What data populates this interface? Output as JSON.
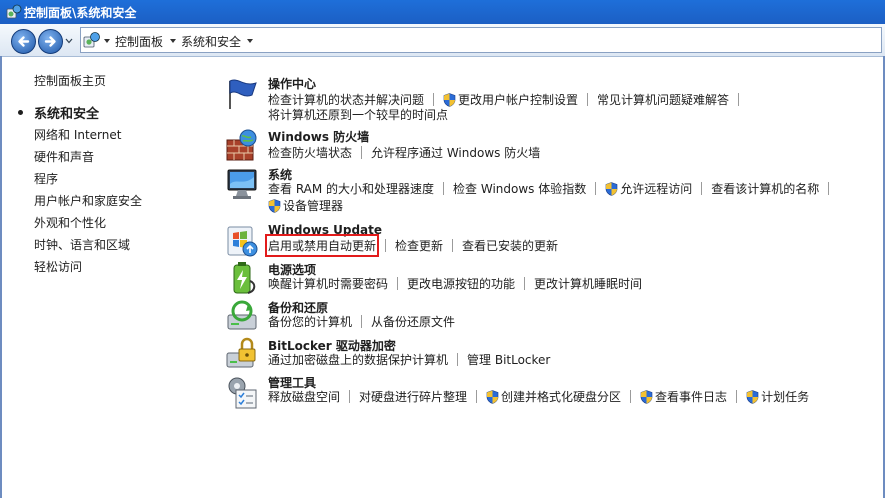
{
  "window": {
    "title": "控制面板\\系统和安全"
  },
  "address": {
    "crumbs": [
      "控制面板",
      "系统和安全"
    ]
  },
  "sidebar": {
    "home": "控制面板主页",
    "items": [
      "系统和安全",
      "网络和 Internet",
      "硬件和声音",
      "程序",
      "用户帐户和家庭安全",
      "外观和个性化",
      "时钟、语言和区域",
      "轻松访问"
    ]
  },
  "categories": {
    "action_center": {
      "title": "操作中心",
      "l1": [
        "检查计算机的状态并解决问题",
        "更改用户帐户控制设置",
        "常见计算机问题疑难解答"
      ],
      "l2": [
        "将计算机还原到一个较早的时间点"
      ]
    },
    "firewall": {
      "title": "Windows 防火墙",
      "l1": [
        "检查防火墙状态",
        "允许程序通过 Windows 防火墙"
      ]
    },
    "system": {
      "title": "系统",
      "l1": [
        "查看 RAM 的大小和处理器速度",
        "检查 Windows 体验指数",
        "允许远程访问",
        "查看该计算机的名称"
      ],
      "l2": [
        "设备管理器"
      ]
    },
    "update": {
      "title": "Windows Update",
      "l1": [
        "启用或禁用自动更新",
        "检查更新",
        "查看已安装的更新"
      ]
    },
    "power": {
      "title": "电源选项",
      "l1": [
        "唤醒计算机时需要密码",
        "更改电源按钮的功能",
        "更改计算机睡眠时间"
      ]
    },
    "backup": {
      "title": "备份和还原",
      "l1": [
        "备份您的计算机",
        "从备份还原文件"
      ]
    },
    "bitlocker": {
      "title": "BitLocker 驱动器加密",
      "l1": [
        "通过加密磁盘上的数据保护计算机",
        "管理 BitLocker"
      ]
    },
    "admin": {
      "title": "管理工具",
      "l1": [
        "释放磁盘空间",
        "对硬盘进行碎片整理",
        "创建并格式化硬盘分区",
        "查看事件日志",
        "计划任务"
      ]
    }
  }
}
